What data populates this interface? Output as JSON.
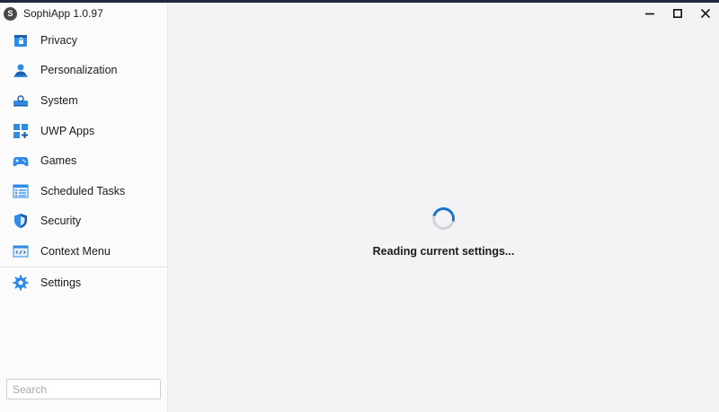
{
  "app": {
    "title": "SophiApp 1.0.97",
    "logo_letter": "S"
  },
  "sidebar": {
    "items": [
      {
        "label": "Privacy",
        "icon": "privacy-icon"
      },
      {
        "label": "Personalization",
        "icon": "personalization-icon"
      },
      {
        "label": "System",
        "icon": "system-icon"
      },
      {
        "label": "UWP Apps",
        "icon": "uwp-apps-icon"
      },
      {
        "label": "Games",
        "icon": "gamepad-icon"
      },
      {
        "label": "Scheduled Tasks",
        "icon": "scheduled-tasks-icon"
      },
      {
        "label": "Security",
        "icon": "shield-icon"
      },
      {
        "label": "Context Menu",
        "icon": "context-menu-icon"
      }
    ],
    "settings": {
      "label": "Settings",
      "icon": "gear-icon"
    },
    "search": {
      "placeholder": "Search",
      "value": ""
    }
  },
  "main": {
    "status_text": "Reading current settings..."
  },
  "colors": {
    "accent": "#1673c9",
    "icon_blue": "#2f8be6",
    "sidebar_bg": "#fbfbfc",
    "main_bg": "#f3f3f5"
  }
}
